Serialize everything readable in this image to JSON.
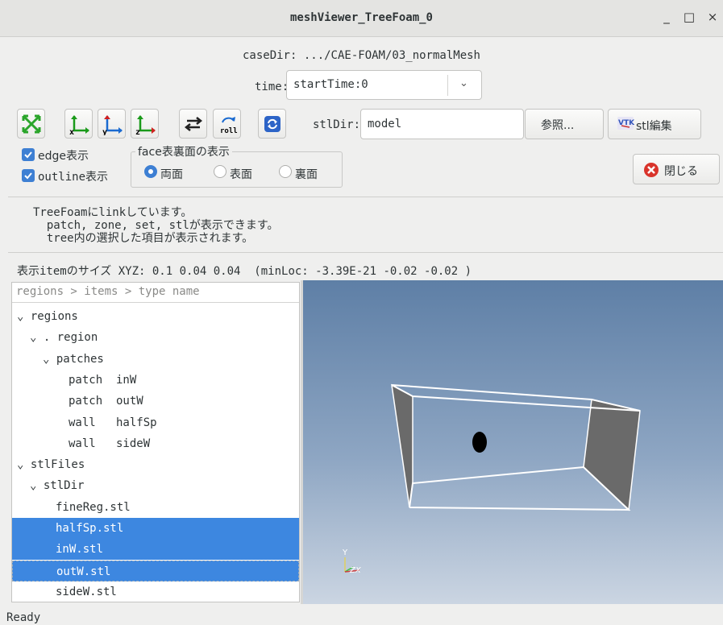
{
  "window": {
    "title": "meshViewer_TreeFoam_0",
    "minimize": "_",
    "maximize": "□",
    "close": "×"
  },
  "caseDir": "caseDir: .../CAE-FOAM/03_normalMesh",
  "time": {
    "label": "time:",
    "value": "startTime:0"
  },
  "toolbar": {
    "icons": [
      "fit-icon",
      "view-x-icon",
      "view-y-icon",
      "view-z-icon",
      "swap-icon",
      "roll-icon",
      "reload-icon"
    ],
    "roll_label": "roll",
    "stlDir_label": "stlDir:",
    "stlDir_value": "model",
    "browse_label": "参照...",
    "stl_edit_label": "stl編集",
    "close_label": "閉じる"
  },
  "options": {
    "edge_label": "edge表示",
    "outline_label": "outline表示",
    "face_group_title": "face表裏面の表示",
    "radios": [
      {
        "label": "両面",
        "checked": true
      },
      {
        "label": "表面",
        "checked": false
      },
      {
        "label": "裏面",
        "checked": false
      }
    ]
  },
  "messages": [
    "TreeFoamにlinkしています。",
    "  patch, zone, set, stlが表示できます。",
    "  tree内の選択した項目が表示されます。"
  ],
  "size_line": "表示itemのサイズ XYZ: 0.1 0.04 0.04  (minLoc: -3.39E-21 -0.02 -0.02 )",
  "tree": {
    "header": "regions > items > type name",
    "rows": [
      {
        "text": "⌄ regions",
        "indent": 0,
        "selected": false
      },
      {
        "text": "⌄ . region",
        "indent": 1,
        "selected": false
      },
      {
        "text": "⌄ patches",
        "indent": 2,
        "selected": false
      },
      {
        "text": "patch  inW",
        "indent": 4,
        "selected": false
      },
      {
        "text": "patch  outW",
        "indent": 4,
        "selected": false
      },
      {
        "text": "wall   halfSp",
        "indent": 4,
        "selected": false
      },
      {
        "text": "wall   sideW",
        "indent": 4,
        "selected": false
      },
      {
        "text": "⌄ stlFiles",
        "indent": 0,
        "selected": false
      },
      {
        "text": "⌄ stlDir",
        "indent": 1,
        "selected": false
      },
      {
        "text": "fineReg.stl",
        "indent": 3,
        "selected": false
      },
      {
        "text": "halfSp.stl",
        "indent": 3,
        "selected": true
      },
      {
        "text": "inW.stl",
        "indent": 3,
        "selected": true
      },
      {
        "text": "outW.stl",
        "indent": 3,
        "selected": true
      },
      {
        "text": "sideW.stl",
        "indent": 3,
        "selected": false
      }
    ]
  },
  "viewport": {
    "axis_y": "Y",
    "axis_zx": "ZX"
  },
  "status": "Ready",
  "colors": {
    "accent": "#3d87e0",
    "viewport_top": "#5e7fa6",
    "viewport_bottom": "#cbd5e2",
    "close_icon": "#d9342b"
  }
}
